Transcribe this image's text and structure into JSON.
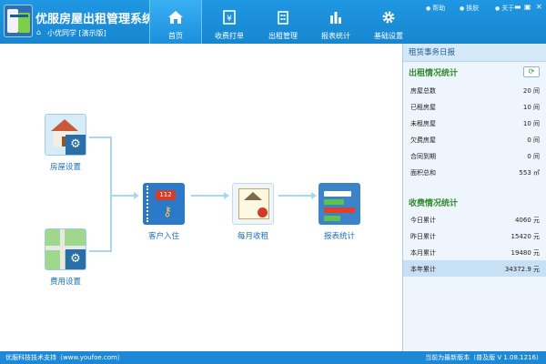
{
  "app": {
    "title": "优服房屋出租管理系统",
    "subtitle": "小优同学 [演示版]"
  },
  "nav": [
    {
      "label": "首页",
      "icon": "home-icon"
    },
    {
      "label": "收费打单",
      "icon": "receipt-icon"
    },
    {
      "label": "出租管理",
      "icon": "building-icon"
    },
    {
      "label": "报表统计",
      "icon": "bar-chart-icon"
    },
    {
      "label": "基础设置",
      "icon": "gear-icon"
    }
  ],
  "topright": {
    "help": "帮助",
    "skin": "换肤",
    "about": "关于"
  },
  "window": {
    "minimize": "▬",
    "maximize": "▣",
    "close": "✕"
  },
  "flow": {
    "house_settings": "房屋设置",
    "fee_settings": "费用设置",
    "tenant_checkin": "客户入住",
    "monthly_rent": "每月收租",
    "report_stats": "报表统计",
    "book_tag": "112"
  },
  "panel": {
    "title": "租赁事务日报",
    "rental_title": "出租情况统计",
    "rental": [
      {
        "label": "房屋总数",
        "value": "20 间"
      },
      {
        "label": "已租房屋",
        "value": "10 间"
      },
      {
        "label": "未租房屋",
        "value": "10 间"
      },
      {
        "label": "欠费房屋",
        "value": "0 间"
      },
      {
        "label": "合同到期",
        "value": "0 间"
      },
      {
        "label": "面积总和",
        "value": "553 ㎡"
      }
    ],
    "fee_title": "收费情况统计",
    "fees": [
      {
        "label": "今日累计",
        "value": "4060 元"
      },
      {
        "label": "昨日累计",
        "value": "15420 元"
      },
      {
        "label": "本月累计",
        "value": "19480 元"
      },
      {
        "label": "本年累计",
        "value": "34372.9 元"
      }
    ]
  },
  "status": {
    "left": "优服科技技术支持（www.youfoe.com）",
    "right": "当前为最新版本（普及版 V 1.08.1216）"
  }
}
